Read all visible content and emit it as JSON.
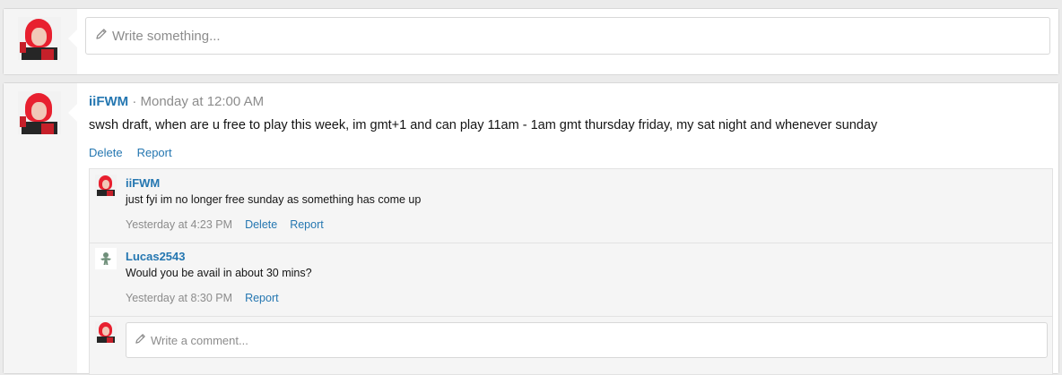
{
  "new_status": {
    "placeholder": "Write something..."
  },
  "post": {
    "author": "iiFWM",
    "separator": " · ",
    "time": "Monday at 12:00 AM",
    "body": "swsh draft, when are u free to play this week, im gmt+1 and can play 11am - 1am gmt thursday friday, my sat night and whenever sunday",
    "actions": {
      "delete": "Delete",
      "report": "Report"
    }
  },
  "comments": [
    {
      "author": "iiFWM",
      "text": "just fyi im no longer free sunday as something has come up",
      "time": "Yesterday at 4:23 PM",
      "actions": {
        "delete": "Delete",
        "report": "Report"
      }
    },
    {
      "author": "Lucas2543",
      "text": "Would you be avail in about 30 mins?",
      "time": "Yesterday at 8:30 PM",
      "actions": {
        "report": "Report"
      }
    }
  ],
  "comment_box": {
    "placeholder": "Write a comment..."
  },
  "colors": {
    "link": "#2577b1",
    "muted": "#8c8c8c",
    "background": "#ebebeb"
  },
  "icons": {
    "pencil": "pencil-icon",
    "avatar_iifwm": "avatar-icon",
    "avatar_lucas": "default-avatar-icon"
  }
}
